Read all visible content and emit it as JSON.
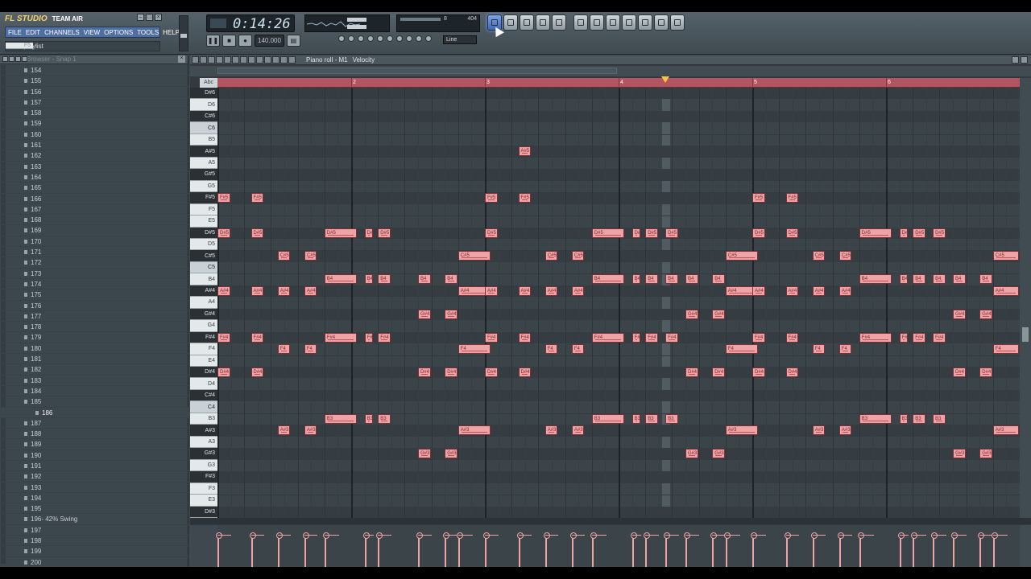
{
  "app": {
    "logo": "FL STUDIO",
    "edition": "TEAM AIR"
  },
  "menu": [
    "FILE",
    "EDIT",
    "CHANNELS",
    "VIEW",
    "OPTIONS",
    "TOOLS",
    "HELP"
  ],
  "hint": {
    "text": "View playlist",
    "shortcut": "F5"
  },
  "time": {
    "display": "0:14:26"
  },
  "tempo": {
    "value": "140.000"
  },
  "cpu": {
    "value1": "8",
    "value2": "404"
  },
  "snap": {
    "value": "Line"
  },
  "browser": {
    "title": "Browser - Snap 1",
    "items": [
      "154",
      "155",
      "156",
      "157",
      "158",
      "159",
      "160",
      "161",
      "162",
      "163",
      "164",
      "165",
      "166",
      "167",
      "168",
      "169",
      "170",
      "171",
      "172",
      "173",
      "174",
      "175",
      "176",
      "177",
      "178",
      "179",
      "180",
      "181",
      "182",
      "183",
      "184",
      "185",
      "186",
      "187",
      "188",
      "189",
      "190",
      "191",
      "192",
      "193",
      "194",
      "195",
      "196- 42% Swing",
      "197",
      "198",
      "199",
      "200"
    ],
    "selected_index": 32
  },
  "piano_roll": {
    "title": "Piano roll - M1",
    "mode": "Velocity",
    "abc_label": "Abc",
    "bars": [
      "2",
      "3",
      "4",
      "5",
      "6"
    ],
    "keys": [
      "D#6",
      "D6",
      "C#6",
      "C6",
      "B5",
      "A#5",
      "A5",
      "G#5",
      "G5",
      "F#5",
      "F5",
      "E5",
      "D#5",
      "D5",
      "C#5",
      "C5",
      "B4",
      "A#4",
      "A4",
      "G#4",
      "G4",
      "F#4",
      "F4",
      "E4",
      "D#4",
      "D4",
      "C#4",
      "C4",
      "B3",
      "A#3",
      "A3",
      "G#3",
      "G3",
      "F#3",
      "F3",
      "E3",
      "D#3"
    ]
  },
  "notes": [
    {
      "p": "F#5",
      "s": 0,
      "l": 1
    },
    {
      "p": "D#5",
      "s": 0,
      "l": 1
    },
    {
      "p": "A#4",
      "s": 0,
      "l": 1
    },
    {
      "p": "F#4",
      "s": 0,
      "l": 1
    },
    {
      "p": "D#4",
      "s": 0,
      "l": 1
    },
    {
      "p": "F#5",
      "s": 2.5,
      "l": 1
    },
    {
      "p": "D#5",
      "s": 2.5,
      "l": 1
    },
    {
      "p": "A#4",
      "s": 2.5,
      "l": 1
    },
    {
      "p": "F#4",
      "s": 2.5,
      "l": 1
    },
    {
      "p": "D#4",
      "s": 2.5,
      "l": 1
    },
    {
      "p": "C#5",
      "s": 4.5,
      "l": 1
    },
    {
      "p": "A#4",
      "s": 4.5,
      "l": 1
    },
    {
      "p": "F4",
      "s": 4.5,
      "l": 1
    },
    {
      "p": "A#3",
      "s": 4.5,
      "l": 1
    },
    {
      "p": "C#5",
      "s": 6.5,
      "l": 1
    },
    {
      "p": "A#4",
      "s": 6.5,
      "l": 1
    },
    {
      "p": "F4",
      "s": 6.5,
      "l": 1
    },
    {
      "p": "A#3",
      "s": 6.5,
      "l": 1
    },
    {
      "p": "D#5",
      "s": 8,
      "l": 2.5
    },
    {
      "p": "B4",
      "s": 8,
      "l": 2.5
    },
    {
      "p": "F#4",
      "s": 8,
      "l": 2.5
    },
    {
      "p": "B3",
      "s": 8,
      "l": 2.5
    },
    {
      "p": "D#5",
      "s": 11,
      "l": 0.7
    },
    {
      "p": "B4",
      "s": 11,
      "l": 0.7
    },
    {
      "p": "F#4",
      "s": 11,
      "l": 0.7
    },
    {
      "p": "B3",
      "s": 11,
      "l": 0.7
    },
    {
      "p": "D#5",
      "s": 12,
      "l": 1
    },
    {
      "p": "B4",
      "s": 12,
      "l": 1
    },
    {
      "p": "F#4",
      "s": 12,
      "l": 1
    },
    {
      "p": "B3",
      "s": 12,
      "l": 1
    },
    {
      "p": "B4",
      "s": 15,
      "l": 1
    },
    {
      "p": "G#4",
      "s": 15,
      "l": 1
    },
    {
      "p": "D#4",
      "s": 15,
      "l": 1
    },
    {
      "p": "G#3",
      "s": 15,
      "l": 1
    },
    {
      "p": "B4",
      "s": 17,
      "l": 1
    },
    {
      "p": "G#4",
      "s": 17,
      "l": 1
    },
    {
      "p": "D#4",
      "s": 17,
      "l": 1
    },
    {
      "p": "G#3",
      "s": 17,
      "l": 1
    },
    {
      "p": "C#5",
      "s": 18,
      "l": 2.5
    },
    {
      "p": "A#4",
      "s": 18,
      "l": 2.5
    },
    {
      "p": "F4",
      "s": 18,
      "l": 2.5
    },
    {
      "p": "A#3",
      "s": 18,
      "l": 2.5
    },
    {
      "p": "F#5",
      "s": 20,
      "l": 1
    },
    {
      "p": "D#5",
      "s": 20,
      "l": 1
    },
    {
      "p": "A#4",
      "s": 20,
      "l": 1
    },
    {
      "p": "F#4",
      "s": 20,
      "l": 1
    },
    {
      "p": "D#4",
      "s": 20,
      "l": 1
    },
    {
      "p": "A#5",
      "s": 22.5,
      "l": 1
    },
    {
      "p": "F#5",
      "s": 22.5,
      "l": 1
    },
    {
      "p": "A#4",
      "s": 22.5,
      "l": 1
    },
    {
      "p": "F#4",
      "s": 22.5,
      "l": 1
    },
    {
      "p": "D#4",
      "s": 22.5,
      "l": 1
    },
    {
      "p": "C#5",
      "s": 24.5,
      "l": 1
    },
    {
      "p": "A#4",
      "s": 24.5,
      "l": 1
    },
    {
      "p": "F4",
      "s": 24.5,
      "l": 1
    },
    {
      "p": "A#3",
      "s": 24.5,
      "l": 1
    },
    {
      "p": "C#5",
      "s": 26.5,
      "l": 1
    },
    {
      "p": "A#4",
      "s": 26.5,
      "l": 1
    },
    {
      "p": "F4",
      "s": 26.5,
      "l": 1
    },
    {
      "p": "A#3",
      "s": 26.5,
      "l": 1
    },
    {
      "p": "D#5",
      "s": 28,
      "l": 2.5
    },
    {
      "p": "B4",
      "s": 28,
      "l": 2.5
    },
    {
      "p": "F#4",
      "s": 28,
      "l": 2.5
    },
    {
      "p": "B3",
      "s": 28,
      "l": 2.5
    },
    {
      "p": "D#5",
      "s": 31,
      "l": 0.7
    },
    {
      "p": "B4",
      "s": 31,
      "l": 0.7
    },
    {
      "p": "F#4",
      "s": 31,
      "l": 0.7
    },
    {
      "p": "B3",
      "s": 31,
      "l": 0.7
    },
    {
      "p": "D#5",
      "s": 32,
      "l": 1
    },
    {
      "p": "B4",
      "s": 32,
      "l": 1
    },
    {
      "p": "F#4",
      "s": 32,
      "l": 1
    },
    {
      "p": "B3",
      "s": 32,
      "l": 1
    },
    {
      "p": "D#5",
      "s": 33.5,
      "l": 1
    },
    {
      "p": "B4",
      "s": 33.5,
      "l": 1
    },
    {
      "p": "F#4",
      "s": 33.5,
      "l": 1
    },
    {
      "p": "B3",
      "s": 33.5,
      "l": 1
    },
    {
      "p": "B4",
      "s": 35,
      "l": 1
    },
    {
      "p": "G#4",
      "s": 35,
      "l": 1
    },
    {
      "p": "D#4",
      "s": 35,
      "l": 1
    },
    {
      "p": "G#3",
      "s": 35,
      "l": 1
    },
    {
      "p": "B4",
      "s": 37,
      "l": 1
    },
    {
      "p": "G#4",
      "s": 37,
      "l": 1
    },
    {
      "p": "D#4",
      "s": 37,
      "l": 1
    },
    {
      "p": "G#3",
      "s": 37,
      "l": 1
    },
    {
      "p": "C#5",
      "s": 38,
      "l": 2.5
    },
    {
      "p": "A#4",
      "s": 38,
      "l": 2.5
    },
    {
      "p": "F4",
      "s": 38,
      "l": 2.5
    },
    {
      "p": "A#3",
      "s": 38,
      "l": 2.5
    },
    {
      "p": "F#5",
      "s": 40,
      "l": 1
    },
    {
      "p": "D#5",
      "s": 40,
      "l": 1
    },
    {
      "p": "A#4",
      "s": 40,
      "l": 1
    },
    {
      "p": "F#4",
      "s": 40,
      "l": 1
    },
    {
      "p": "D#4",
      "s": 40,
      "l": 1
    },
    {
      "p": "F#5",
      "s": 42.5,
      "l": 1
    },
    {
      "p": "D#5",
      "s": 42.5,
      "l": 1
    },
    {
      "p": "A#4",
      "s": 42.5,
      "l": 1
    },
    {
      "p": "F#4",
      "s": 42.5,
      "l": 1
    },
    {
      "p": "D#4",
      "s": 42.5,
      "l": 1
    },
    {
      "p": "C#5",
      "s": 44.5,
      "l": 1
    },
    {
      "p": "A#4",
      "s": 44.5,
      "l": 1
    },
    {
      "p": "F4",
      "s": 44.5,
      "l": 1
    },
    {
      "p": "A#3",
      "s": 44.5,
      "l": 1
    },
    {
      "p": "C#5",
      "s": 46.5,
      "l": 1
    },
    {
      "p": "A#4",
      "s": 46.5,
      "l": 1
    },
    {
      "p": "F4",
      "s": 46.5,
      "l": 1
    },
    {
      "p": "A#3",
      "s": 46.5,
      "l": 1
    },
    {
      "p": "D#5",
      "s": 48,
      "l": 2.5
    },
    {
      "p": "B4",
      "s": 48,
      "l": 2.5
    },
    {
      "p": "F#4",
      "s": 48,
      "l": 2.5
    },
    {
      "p": "B3",
      "s": 48,
      "l": 2.5
    },
    {
      "p": "D#5",
      "s": 51,
      "l": 0.7
    },
    {
      "p": "B4",
      "s": 51,
      "l": 0.7
    },
    {
      "p": "F#4",
      "s": 51,
      "l": 0.7
    },
    {
      "p": "B3",
      "s": 51,
      "l": 0.7
    },
    {
      "p": "D#5",
      "s": 52,
      "l": 1
    },
    {
      "p": "B4",
      "s": 52,
      "l": 1
    },
    {
      "p": "F#4",
      "s": 52,
      "l": 1
    },
    {
      "p": "B3",
      "s": 52,
      "l": 1
    },
    {
      "p": "D#5",
      "s": 53.5,
      "l": 1
    },
    {
      "p": "B4",
      "s": 53.5,
      "l": 1
    },
    {
      "p": "F#4",
      "s": 53.5,
      "l": 1
    },
    {
      "p": "B3",
      "s": 53.5,
      "l": 1
    },
    {
      "p": "B4",
      "s": 55,
      "l": 1
    },
    {
      "p": "G#4",
      "s": 55,
      "l": 1
    },
    {
      "p": "D#4",
      "s": 55,
      "l": 1
    },
    {
      "p": "G#3",
      "s": 55,
      "l": 1
    },
    {
      "p": "B4",
      "s": 57,
      "l": 1
    },
    {
      "p": "G#4",
      "s": 57,
      "l": 1
    },
    {
      "p": "D#4",
      "s": 57,
      "l": 1
    },
    {
      "p": "G#3",
      "s": 57,
      "l": 1
    },
    {
      "p": "C#5",
      "s": 58,
      "l": 2
    },
    {
      "p": "A#4",
      "s": 58,
      "l": 2
    },
    {
      "p": "F4",
      "s": 58,
      "l": 2
    },
    {
      "p": "A#3",
      "s": 58,
      "l": 2
    }
  ],
  "colors": {
    "note": "#f0a3a5",
    "ruler": "#b35560",
    "active_button": "#4f7fd6"
  }
}
